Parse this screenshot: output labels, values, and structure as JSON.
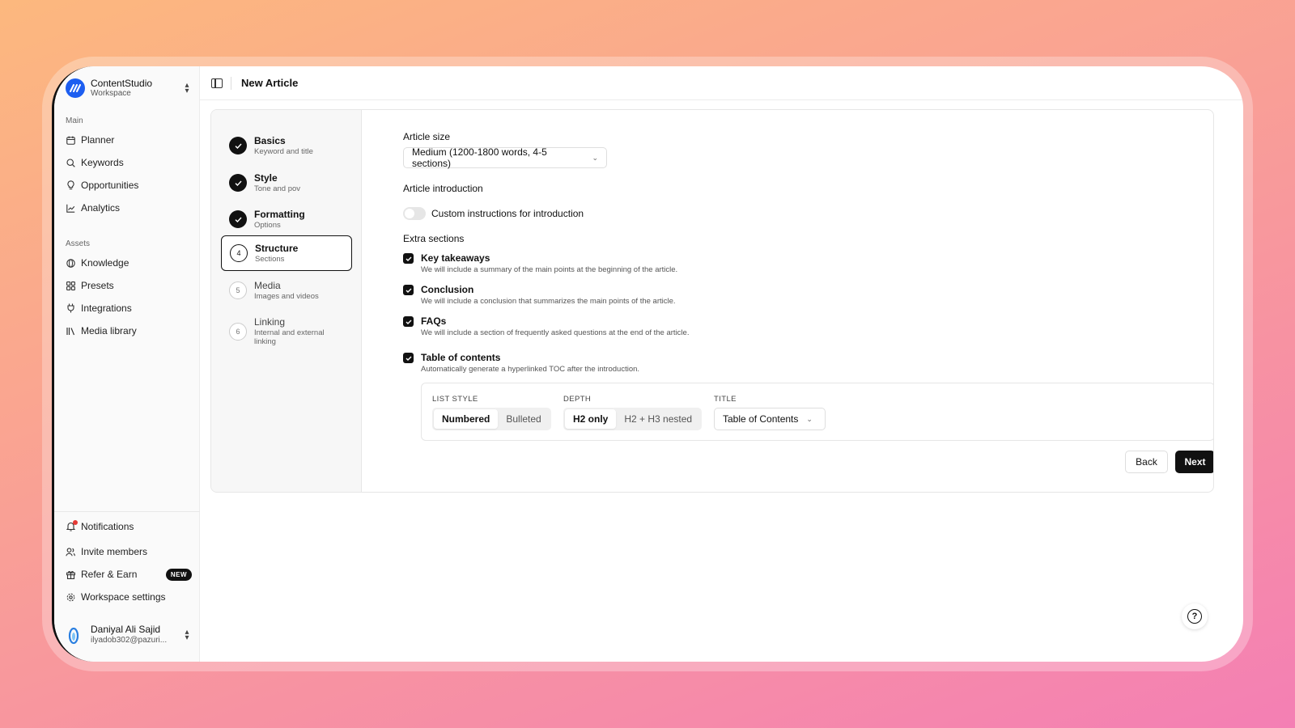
{
  "workspace": {
    "name": "ContentStudio",
    "subtitle": "Workspace"
  },
  "sidebar": {
    "main_label": "Main",
    "main_items": [
      {
        "label": "Planner",
        "icon": "calendar-icon"
      },
      {
        "label": "Keywords",
        "icon": "search-icon"
      },
      {
        "label": "Opportunities",
        "icon": "lightbulb-icon"
      },
      {
        "label": "Analytics",
        "icon": "chart-icon"
      }
    ],
    "assets_label": "Assets",
    "assets_items": [
      {
        "label": "Knowledge",
        "icon": "globe-icon"
      },
      {
        "label": "Presets",
        "icon": "grid-icon"
      },
      {
        "label": "Integrations",
        "icon": "plug-icon"
      },
      {
        "label": "Media library",
        "icon": "library-icon"
      }
    ],
    "bottom_items": [
      {
        "label": "Notifications",
        "icon": "bell-icon"
      },
      {
        "label": "Invite members",
        "icon": "users-icon"
      },
      {
        "label": "Refer & Earn",
        "icon": "gift-icon",
        "badge": "NEW"
      },
      {
        "label": "Workspace settings",
        "icon": "gear-icon"
      }
    ],
    "user": {
      "name": "Daniyal Ali Sajid",
      "email": "ilyadob302@pazuri..."
    }
  },
  "header": {
    "title": "New Article"
  },
  "steps": [
    {
      "number": "1",
      "title": "Basics",
      "subtitle": "Keyword and title",
      "state": "done"
    },
    {
      "number": "2",
      "title": "Style",
      "subtitle": "Tone and pov",
      "state": "done"
    },
    {
      "number": "3",
      "title": "Formatting",
      "subtitle": "Options",
      "state": "done"
    },
    {
      "number": "4",
      "title": "Structure",
      "subtitle": "Sections",
      "state": "current"
    },
    {
      "number": "5",
      "title": "Media",
      "subtitle": "Images and videos",
      "state": "todo"
    },
    {
      "number": "6",
      "title": "Linking",
      "subtitle": "Internal and external linking",
      "state": "todo"
    }
  ],
  "form": {
    "article_size_label": "Article size",
    "article_size_value": "Medium (1200-1800 words, 4-5 sections)",
    "introduction_label": "Article introduction",
    "custom_intro_label": "Custom instructions for introduction",
    "custom_intro_enabled": false,
    "extra_sections_label": "Extra sections",
    "extra_sections": [
      {
        "title": "Key takeaways",
        "description": "We will include a summary of the main points at the beginning of the article.",
        "checked": true
      },
      {
        "title": "Conclusion",
        "description": "We will include a conclusion that summarizes the main points of the article.",
        "checked": true
      },
      {
        "title": "FAQs",
        "description": "We will include a section of frequently asked questions at the end of the article.",
        "checked": true
      },
      {
        "title": "Table of contents",
        "description": "Automatically generate a hyperlinked TOC after the introduction.",
        "checked": true
      }
    ],
    "toc": {
      "list_style_label": "LIST STYLE",
      "list_style_options": [
        "Numbered",
        "Bulleted"
      ],
      "list_style_selected": "Numbered",
      "depth_label": "DEPTH",
      "depth_options": [
        "H2 only",
        "H2 + H3 nested"
      ],
      "depth_selected": "H2 only",
      "title_label": "TITLE",
      "title_value": "Table of Contents"
    },
    "back_label": "Back",
    "next_label": "Next"
  },
  "colors": {
    "accent": "#111111",
    "workspace_logo": "#1d5ef0",
    "notification_dot": "#e53935"
  }
}
